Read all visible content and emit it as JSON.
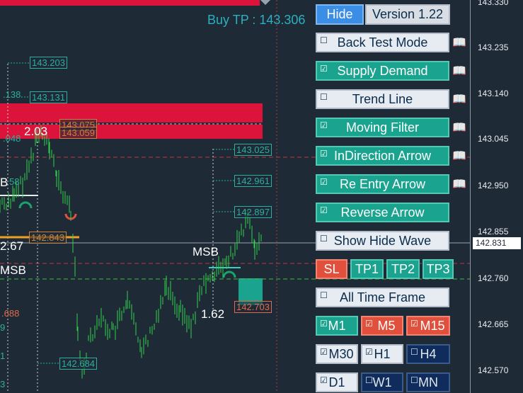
{
  "chart": {
    "buy_tp": "Buy TP : 143.306",
    "price_labels": [
      "143.203",
      "143.131",
      "143.075",
      "143.059",
      "143.025",
      "142.961",
      "142.897",
      "142.843",
      "142.703",
      "142.684"
    ],
    "cut_labels": [
      ".138",
      ".048",
      "58",
      ".688",
      "9",
      "1",
      "3"
    ],
    "wave_labels": [
      "2.03",
      "B",
      "2.67",
      "MSB",
      "MSB",
      "1.62"
    ],
    "axis_ticks": [
      "143.330",
      "143.235",
      "143.140",
      "143.045",
      "142.950",
      "142.855",
      "142.760",
      "142.665",
      "142.570"
    ],
    "current_price": "142.831",
    "colors": {
      "background": "#1f2a37",
      "candle": "#32d24a",
      "zone": "#dc143c",
      "teal": "#2bb09a"
    }
  },
  "panel": {
    "hide": "Hide",
    "version": "Version 1.22",
    "options": [
      {
        "label": "Back Test Mode",
        "checked": false,
        "check": "☐"
      },
      {
        "label": "Supply Demand",
        "checked": true,
        "check": "☑"
      },
      {
        "label": "Trend Line",
        "checked": false,
        "check": "☐"
      },
      {
        "label": "Moving Filter",
        "checked": true,
        "check": "☑"
      },
      {
        "label": "InDirection Arrow",
        "checked": true,
        "check": "☑"
      },
      {
        "label": "Re Entry Arrow",
        "checked": true,
        "check": "☑"
      },
      {
        "label": "Reverse Arrow",
        "checked": true,
        "check": "☑"
      },
      {
        "label": "Show Hide Wave",
        "checked": false,
        "check": "☐"
      }
    ],
    "book_icon": "📖",
    "sl_tp": [
      "SL",
      "TP1",
      "TP2",
      "TP3"
    ],
    "all_tf": {
      "label": "All Time Frame",
      "check": "☐"
    },
    "timeframes": [
      {
        "label": "M1",
        "checked": true,
        "check": "☑"
      },
      {
        "label": "M5",
        "checked": true,
        "check": "☑"
      },
      {
        "label": "M15",
        "checked": true,
        "check": "☑"
      },
      {
        "label": "M30",
        "checked": true,
        "check": "☑"
      },
      {
        "label": "H1",
        "checked": true,
        "check": "☑"
      },
      {
        "label": "H4",
        "checked": false,
        "check": "☐"
      },
      {
        "label": "D1",
        "checked": true,
        "check": "☑"
      },
      {
        "label": "W1",
        "checked": false,
        "check": "☐"
      },
      {
        "label": "MN",
        "checked": false,
        "check": "☐"
      }
    ]
  }
}
